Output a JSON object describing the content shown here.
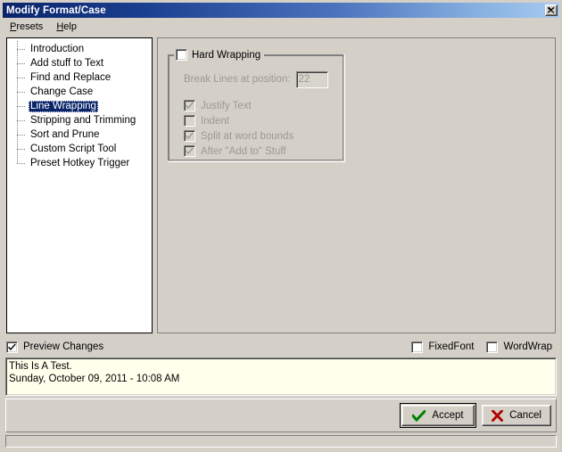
{
  "window": {
    "title": "Modify Format/Case",
    "close_icon": "close-icon"
  },
  "menubar": {
    "items": [
      {
        "label": "Presets",
        "accel": "P",
        "rest": "resets"
      },
      {
        "label": "Help",
        "accel": "H",
        "rest": "elp"
      }
    ]
  },
  "tree": {
    "items": [
      {
        "label": "Introduction",
        "selected": false
      },
      {
        "label": "Add stuff to Text",
        "selected": false
      },
      {
        "label": "Find and Replace",
        "selected": false
      },
      {
        "label": "Change Case",
        "selected": false
      },
      {
        "label": "Line Wrapping",
        "selected": true
      },
      {
        "label": "Stripping and Trimming",
        "selected": false
      },
      {
        "label": "Sort and Prune",
        "selected": false
      },
      {
        "label": "Custom Script Tool",
        "selected": false
      },
      {
        "label": "Preset Hotkey Trigger",
        "selected": false
      }
    ]
  },
  "panel": {
    "groupbox": {
      "title": "Hard Wrapping",
      "checked": false,
      "break_lines": {
        "label": "Break Lines at position:",
        "value": "22",
        "enabled": false
      },
      "options": [
        {
          "label": "Justify Text",
          "checked": true,
          "enabled": false
        },
        {
          "label": "Indent",
          "checked": false,
          "enabled": false
        },
        {
          "label": "Split at word bounds",
          "checked": true,
          "enabled": false
        },
        {
          "label": "After \"Add to\" Stuff",
          "checked": true,
          "enabled": false
        }
      ]
    }
  },
  "options_bar": {
    "preview_changes": {
      "label": "Preview Changes",
      "checked": true
    },
    "fixed_font": {
      "label": "FixedFont",
      "checked": false
    },
    "word_wrap": {
      "label": "WordWrap",
      "checked": false
    }
  },
  "preview": {
    "lines": [
      "This Is A Test.",
      "Sunday, October 09, 2011 - 10:08 AM"
    ]
  },
  "buttons": {
    "accept": {
      "label": "Accept",
      "icon": "green-check-icon",
      "default": true
    },
    "cancel": {
      "label": "Cancel",
      "icon": "red-x-icon",
      "default": false
    }
  },
  "colors": {
    "title_start": "#0a246a",
    "title_end": "#a6caf0",
    "face": "#d4d0c8",
    "selection": "#0a246a",
    "preview_bg": "#ffffec",
    "accept_icon": "#008000",
    "cancel_icon": "#b00000",
    "disabled_text": "#9a9a93"
  }
}
